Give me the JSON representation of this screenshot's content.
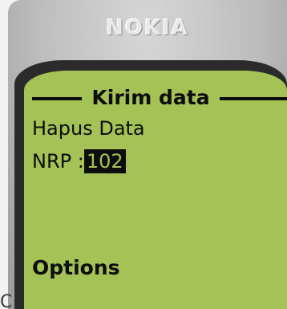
{
  "phone": {
    "brand": "NOKIA"
  },
  "screen": {
    "title": "Kirim data",
    "menu_item": "Hapus Data",
    "field_label": "NRP :",
    "field_value": "102",
    "softkey_label": "Options"
  },
  "corner_glyph": "C",
  "colors": {
    "lcd_background": "#a4c256",
    "lcd_text": "#0d0d0d",
    "bezel": "#2b2b2b",
    "phone_body": "#bdbdbd"
  }
}
